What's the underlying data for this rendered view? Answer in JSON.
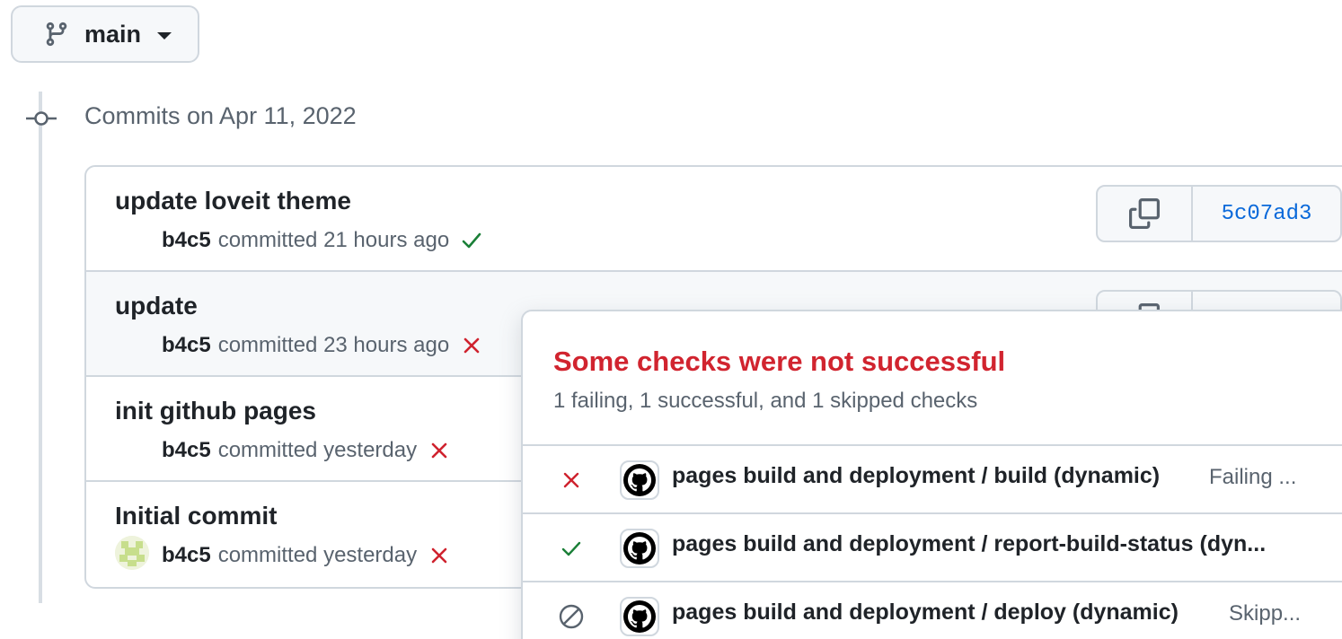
{
  "branch": {
    "name": "main"
  },
  "group": {
    "title": "Commits on Apr 11, 2022"
  },
  "commits": [
    {
      "title": "update loveit theme",
      "author": "b4c5",
      "meta": "committed 21 hours ago",
      "status": "success",
      "sha": "5c07ad3"
    },
    {
      "title": "update",
      "author": "b4c5",
      "meta": "committed 23 hours ago",
      "status": "failure"
    },
    {
      "title": "init github pages",
      "author": "b4c5",
      "meta": "committed yesterday",
      "status": "failure"
    },
    {
      "title": "Initial commit",
      "author": "b4c5",
      "meta": "committed yesterday",
      "status": "failure"
    }
  ],
  "popover": {
    "title": "Some checks were not successful",
    "subtitle": "1 failing, 1 successful, and 1 skipped checks",
    "checks": [
      {
        "state": "failure",
        "name": "pages build and deployment / build (dynamic)",
        "status": "Failing ..."
      },
      {
        "state": "success",
        "name": "pages build and deployment / report-build-status (dyn...",
        "status": ""
      },
      {
        "state": "skipped",
        "name": "pages build and deployment / deploy (dynamic)",
        "status": "Skipp..."
      }
    ]
  },
  "colors": {
    "success": "#1a7f37",
    "failure": "#cf222e",
    "link": "#0969da",
    "error_title": "#d1242f"
  },
  "icons": {
    "branch": "git-branch-icon",
    "commit": "git-commit-icon",
    "copy": "copy-icon",
    "app": "github-logo-icon"
  }
}
